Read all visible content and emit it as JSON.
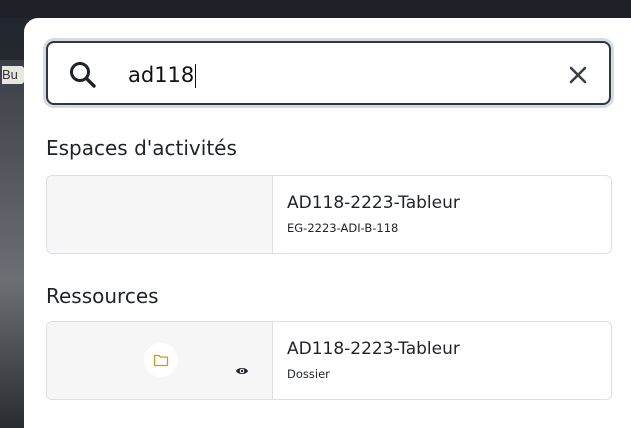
{
  "background_label": "Bu",
  "search": {
    "value": "ad118",
    "icon": "search-icon",
    "clear_icon": "close-icon"
  },
  "sections": [
    {
      "title": "Espaces d'activités",
      "items": [
        {
          "title": "AD118-2223-Tableur",
          "subtitle": "EG-2223-ADI-B-118"
        }
      ]
    },
    {
      "title": "Ressources",
      "items": [
        {
          "title": "AD118-2223-Tableur",
          "subtitle": "Dossier",
          "thumb_icon": "folder-icon",
          "badge_icon": "eye-icon"
        }
      ]
    }
  ],
  "colors": {
    "folder": "#c99a1e",
    "border": "#2f3740"
  }
}
